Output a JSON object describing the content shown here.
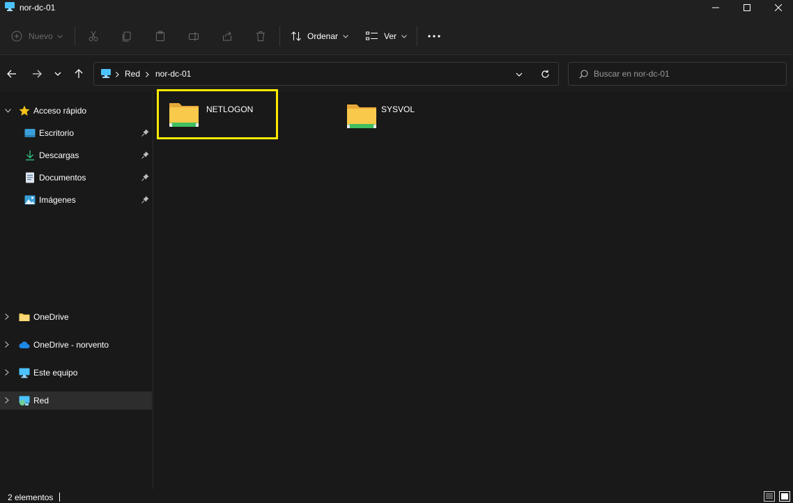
{
  "window": {
    "title": "nor-dc-01"
  },
  "toolbar": {
    "new_label": "Nuevo",
    "sort_label": "Ordenar",
    "view_label": "Ver"
  },
  "address": {
    "breadcrumbs": [
      "Red",
      "nor-dc-01"
    ]
  },
  "search": {
    "placeholder": "Buscar en nor-dc-01"
  },
  "sidebar": {
    "quick_access": {
      "label": "Acceso rápido",
      "items": [
        {
          "label": "Escritorio",
          "icon": "desktop-icon"
        },
        {
          "label": "Descargas",
          "icon": "download-icon"
        },
        {
          "label": "Documentos",
          "icon": "documents-icon"
        },
        {
          "label": "Imágenes",
          "icon": "pictures-icon"
        }
      ]
    },
    "roots": [
      {
        "label": "OneDrive",
        "icon": "folder-icon"
      },
      {
        "label": "OneDrive - norvento",
        "icon": "cloud-icon"
      },
      {
        "label": "Este equipo",
        "icon": "computer-icon"
      },
      {
        "label": "Red",
        "icon": "network-icon",
        "selected": true
      }
    ]
  },
  "content": {
    "items": [
      {
        "name": "NETLOGON",
        "icon": "shared-folder-icon",
        "highlighted": true
      },
      {
        "name": "SYSVOL",
        "icon": "shared-folder-icon",
        "highlighted": false
      }
    ]
  },
  "status": {
    "count_text": "2 elementos"
  },
  "colors": {
    "background": "#191919",
    "chrome": "#202020",
    "highlight": "#ffea00",
    "folder": "#f8c94a",
    "share_strip": "#3fbf5f",
    "accent": "#4cc2ff"
  }
}
